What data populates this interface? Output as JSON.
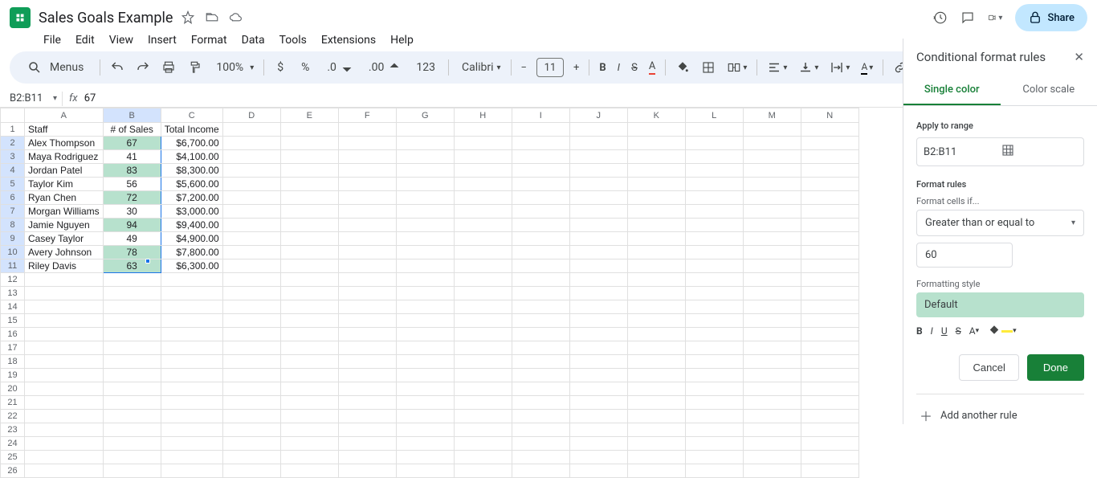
{
  "header": {
    "title": "Sales Goals Example",
    "share": "Share"
  },
  "menu": [
    "File",
    "Edit",
    "View",
    "Insert",
    "Format",
    "Data",
    "Tools",
    "Extensions",
    "Help"
  ],
  "toolbar": {
    "menus": "Menus",
    "zoom": "100%",
    "currency": "$",
    "percent": "%",
    "number_format": "123",
    "font": "Calibri",
    "font_size": "11"
  },
  "namebox": "B2:B11",
  "fx_value": "67",
  "columns": [
    "A",
    "B",
    "C",
    "D",
    "E",
    "F",
    "G",
    "H",
    "I",
    "J",
    "K",
    "L",
    "M",
    "N"
  ],
  "headers": {
    "A": "Staff",
    "B": "# of Sales",
    "C": "Total Income"
  },
  "rows": [
    {
      "staff": "Alex Thompson",
      "sales": "67",
      "income": "$6,700.00",
      "hl": true
    },
    {
      "staff": "Maya Rodriguez",
      "sales": "41",
      "income": "$4,100.00",
      "hl": false
    },
    {
      "staff": "Jordan Patel",
      "sales": "83",
      "income": "$8,300.00",
      "hl": true
    },
    {
      "staff": "Taylor Kim",
      "sales": "56",
      "income": "$5,600.00",
      "hl": false
    },
    {
      "staff": "Ryan Chen",
      "sales": "72",
      "income": "$7,200.00",
      "hl": true
    },
    {
      "staff": "Morgan Williams",
      "sales": "30",
      "income": "$3,000.00",
      "hl": false
    },
    {
      "staff": "Jamie Nguyen",
      "sales": "94",
      "income": "$9,400.00",
      "hl": true
    },
    {
      "staff": "Casey Taylor",
      "sales": "49",
      "income": "$4,900.00",
      "hl": false
    },
    {
      "staff": "Avery Johnson",
      "sales": "78",
      "income": "$7,800.00",
      "hl": true
    },
    {
      "staff": "Riley Davis",
      "sales": "63",
      "income": "$6,300.00",
      "hl": true
    }
  ],
  "empty_rows": 15,
  "sidebar": {
    "title": "Conditional format rules",
    "tabs": {
      "single": "Single color",
      "scale": "Color scale"
    },
    "apply_to_range_label": "Apply to range",
    "range": "B2:B11",
    "format_rules_label": "Format rules",
    "format_cells_if_label": "Format cells if...",
    "condition": "Greater than or equal to",
    "condition_value": "60",
    "formatting_style_label": "Formatting style",
    "style_name": "Default",
    "cancel": "Cancel",
    "done": "Done",
    "add_rule": "Add another rule"
  }
}
